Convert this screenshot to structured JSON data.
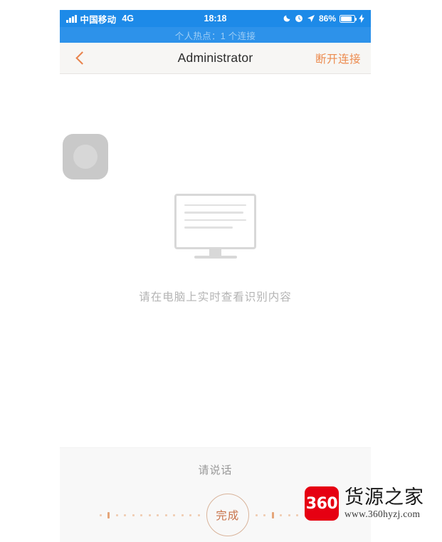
{
  "status_bar": {
    "signal_icon": "signal-bars-icon",
    "carrier": "中国移动",
    "network_type": "4G",
    "time": "18:18",
    "do_not_disturb_icon": "moon-icon",
    "alarm_icon": "alarm-clock-icon",
    "location_icon": "location-arrow-icon",
    "battery_percent": "86%",
    "battery_icon": "battery-icon",
    "charging_icon": "lightning-bolt-icon",
    "background_color": "#1d8ae8"
  },
  "hotspot_banner": {
    "text": "个人热点：1 个连接",
    "background_color": "#2d92ea",
    "text_color": "#9dcdf5"
  },
  "nav_bar": {
    "back_icon": "chevron-left-icon",
    "title": "Administrator",
    "action_label": "断开连接",
    "accent_color": "#ec8b4f"
  },
  "main": {
    "avatar_placeholder_icon": "avatar-placeholder-icon",
    "monitor_icon": "desktop-monitor-icon",
    "hint_text": "请在电脑上实时查看识别内容",
    "hint_color": "#b4b4b4"
  },
  "speak_panel": {
    "prompt": "请说话",
    "done_label": "完成",
    "button_border_color": "#d9b49b",
    "button_text_color": "#c8734a",
    "waveform_color": "#f0cdb3",
    "background_color": "#f8f8f8"
  },
  "watermark": {
    "logo_text": "360",
    "brand": "货源之家",
    "url": "www.360hyzj.com",
    "logo_color": "#e60012"
  }
}
